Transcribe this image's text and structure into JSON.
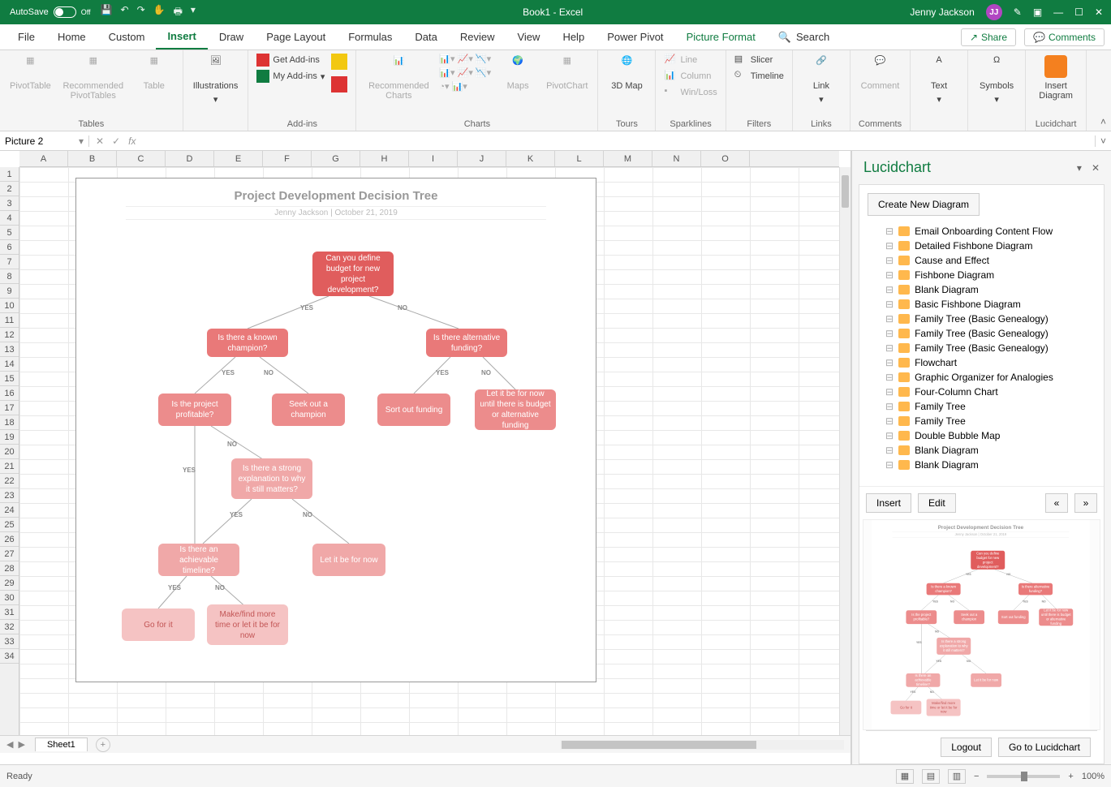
{
  "titlebar": {
    "autosave_label": "AutoSave",
    "autosave_state": "Off",
    "doc_title": "Book1 - Excel",
    "user_name": "Jenny Jackson",
    "user_initials": "JJ"
  },
  "tabs": {
    "file": "File",
    "home": "Home",
    "custom": "Custom",
    "insert": "Insert",
    "draw": "Draw",
    "page_layout": "Page Layout",
    "formulas": "Formulas",
    "data": "Data",
    "review": "Review",
    "view": "View",
    "help": "Help",
    "power_pivot": "Power Pivot",
    "picture_format": "Picture Format",
    "search": "Search",
    "share": "Share",
    "comments": "Comments"
  },
  "ribbon": {
    "tables": {
      "pivot": "PivotTable",
      "rec": "Recommended PivotTables",
      "table": "Table",
      "label": "Tables"
    },
    "illustrations": {
      "btn": "Illustrations",
      "label": "Illustrations"
    },
    "addins_group": {
      "get": "Get Add-ins",
      "my": "My Add-ins",
      "label": "Add-ins"
    },
    "charts": {
      "rec": "Recommended Charts",
      "maps": "Maps",
      "pivotchart": "PivotChart",
      "label": "Charts"
    },
    "tours": {
      "map3d": "3D Map",
      "label": "Tours"
    },
    "sparklines": {
      "line": "Line",
      "column": "Column",
      "winloss": "Win/Loss",
      "label": "Sparklines"
    },
    "filters": {
      "slicer": "Slicer",
      "timeline": "Timeline",
      "label": "Filters"
    },
    "links": {
      "link": "Link",
      "label": "Links"
    },
    "comments_g": {
      "comment": "Comment",
      "label": "Comments"
    },
    "text": {
      "text": "Text",
      "label": ""
    },
    "symbols": {
      "symbols": "Symbols",
      "label": ""
    },
    "lucid": {
      "insert": "Insert Diagram",
      "label": "Lucidchart"
    }
  },
  "namebox": "Picture 2",
  "columns": [
    "A",
    "B",
    "C",
    "D",
    "E",
    "F",
    "G",
    "H",
    "I",
    "J",
    "K",
    "L",
    "M",
    "N",
    "O"
  ],
  "row_count": 34,
  "diagram": {
    "title": "Project Development Decision Tree",
    "subtitle": "Jenny Jackson  |  October 21, 2019",
    "nodes": {
      "root": "Can you define budget for new project development?",
      "champ": "Is there a known champion?",
      "alt": "Is there alternative funding?",
      "profit": "Is the project profitable?",
      "seek": "Seek out a champion",
      "sort": "Sort out funding",
      "letbe": "Let it be for now until there is budget or alternative funding",
      "strong": "Is there a strong explanation to why it still matters?",
      "timeline": "Is there an achievable timeline?",
      "letnow": "Let it be for now",
      "go": "Go for it",
      "make": "Make/find more time or let it be for now"
    },
    "labels": {
      "yes": "YES",
      "no": "NO"
    }
  },
  "sheet": {
    "name": "Sheet1"
  },
  "panel": {
    "title": "Lucidchart",
    "create": "Create New Diagram",
    "items": [
      "Email Onboarding Content Flow",
      "Detailed Fishbone Diagram",
      "Cause and Effect",
      "Fishbone Diagram",
      "Blank Diagram",
      "Basic Fishbone Diagram",
      "Family Tree (Basic Genealogy)",
      "Family Tree (Basic Genealogy)",
      "Family Tree (Basic Genealogy)",
      "Flowchart",
      "Graphic Organizer for Analogies",
      "Four-Column Chart",
      "Family Tree",
      "Family Tree",
      "Double Bubble Map",
      "Blank Diagram",
      "Blank Diagram"
    ],
    "insert": "Insert",
    "edit": "Edit",
    "logout": "Logout",
    "goto": "Go to Lucidchart"
  },
  "status": {
    "ready": "Ready",
    "zoom": "100%"
  }
}
